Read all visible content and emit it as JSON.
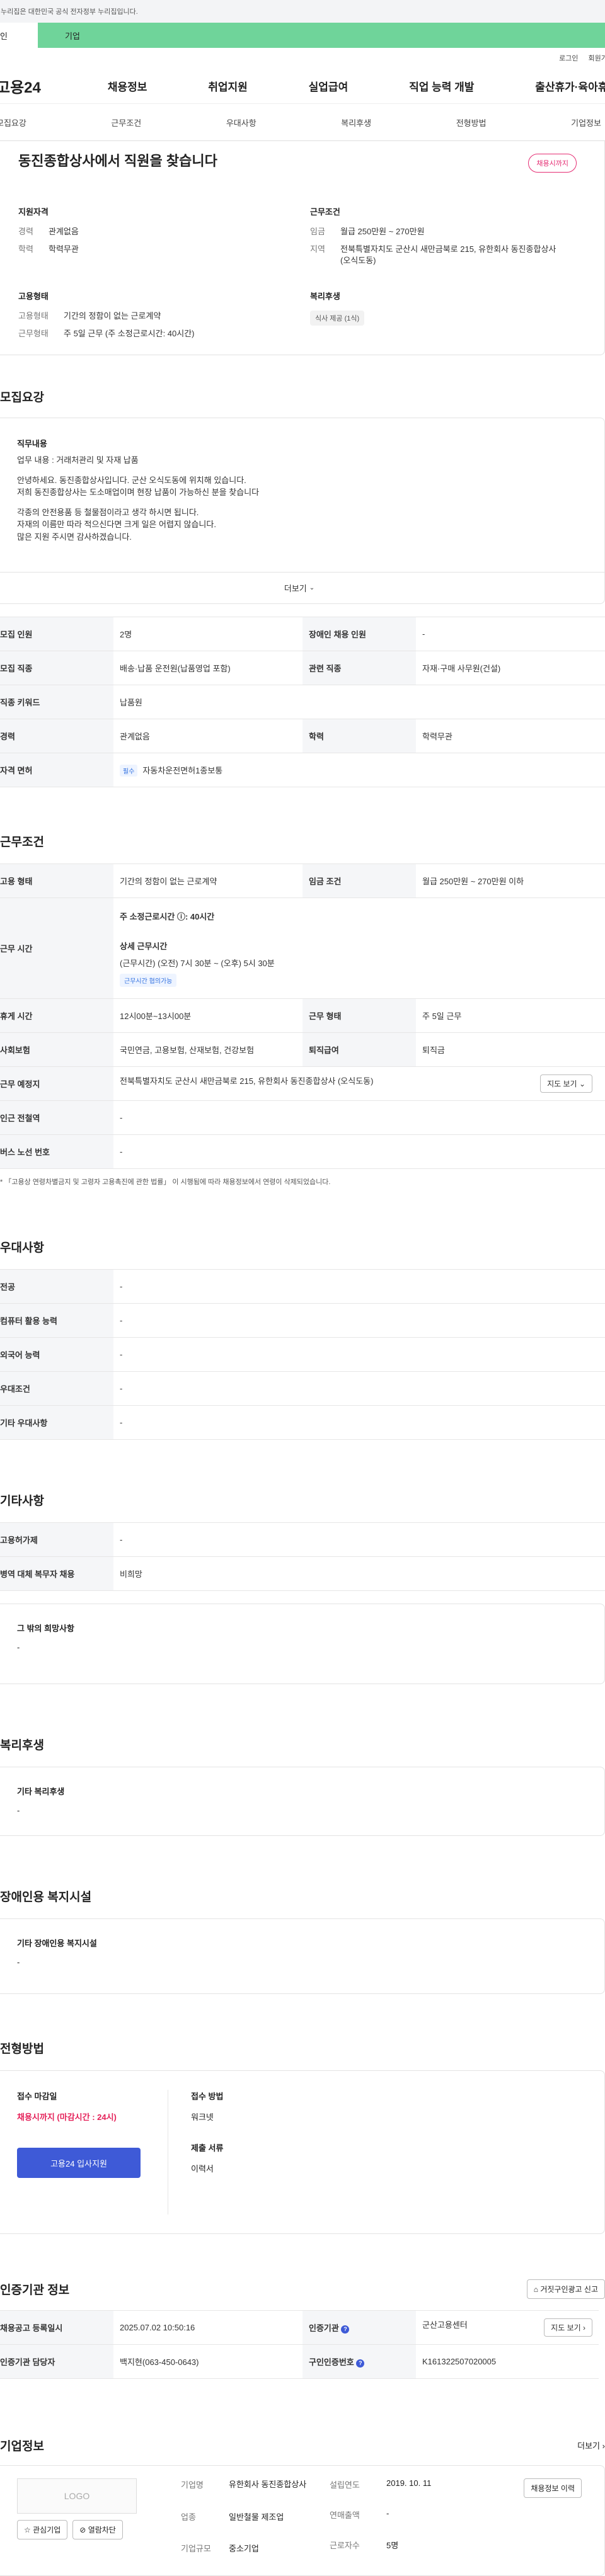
{
  "top_notice": "이 누리집은 대한민국 공식 전자정부 누리집입니다.",
  "mode": {
    "left": "개인",
    "right": "기업"
  },
  "util": {
    "login": "로그인",
    "join": "회원가입"
  },
  "gnb": {
    "logo": "고용24",
    "menus": [
      "채용정보",
      "취업지원",
      "실업급여",
      "직업 능력 개발",
      "출산휴가·육아휴직"
    ]
  },
  "tabs": [
    "모집요강",
    "근무조건",
    "우대사항",
    "복리후생",
    "전형방법",
    "기업정보"
  ],
  "summary": {
    "title": "동진종합상사에서 직원을 찾습니다",
    "badge": "채용시까지",
    "qual_title": "지원자격",
    "qual": [
      {
        "k": "경력",
        "v": "관계없음"
      },
      {
        "k": "학력",
        "v": "학력무관"
      }
    ],
    "cond_title": "근무조건",
    "cond": [
      {
        "k": "임금",
        "v": "월급 250만원 ~ 270만원"
      },
      {
        "k": "지역",
        "v": "전북특별자치도 군산시 새만금북로 215, 유한회사 동진종합상사 (오식도동)"
      }
    ],
    "emp_title": "고용형태",
    "emp": [
      {
        "k": "고용형태",
        "v": "기간의 정함이 없는 근로계약"
      },
      {
        "k": "근무형태",
        "v": "주 5일 근무 (주 소정근로시간: 40시간)"
      }
    ],
    "welfare_title": "복리후생",
    "welfare_chip": "식사 제공 (1식)"
  },
  "recruit": {
    "heading": "모집요강",
    "desc_title": "직무내용",
    "desc_lines": [
      "업무 내용 : 거래처관리 및 자재 납품",
      "",
      "안녕하세요. 동진종합상사입니다. 군산 오식도동에 위치해 있습니다.",
      "저희 동진종합상사는 도소매업이며 현장 납품이 가능하신 분을 찾습니다",
      "",
      "각종의 안전용품 등 철물점이라고 생각 하시면 됩니다.",
      "자재의 이름만 따라 적으신다면 크게 일은 어렵지 않습니다.",
      "많은 지원 주시면 감사하겠습니다."
    ],
    "more": "더보기",
    "rows": {
      "headcount_k": "모집 인원",
      "headcount_v": "2명",
      "disabled_k": "장애인 채용 인원",
      "disabled_v": "-",
      "job_k": "모집 직종",
      "job_v": "배송·납품 운전원(납품영업 포함)",
      "related_k": "관련 직종",
      "related_v": "자재·구매 사무원(건설)",
      "keyword_k": "직종 키워드",
      "keyword_v": "납품원",
      "career_k": "경력",
      "career_v": "관계없음",
      "edu_k": "학력",
      "edu_v": "학력무관",
      "license_k": "자격 면허",
      "license_tag": "필수",
      "license_v": "자동차운전면허1종보통"
    }
  },
  "conditions": {
    "heading": "근무조건",
    "emp_k": "고용 형태",
    "emp_v": "기간의 정함이 없는 근로계약",
    "wage_k": "임금 조건",
    "wage_v": "월급 250만원 ~ 270만원 이하",
    "hours_k": "근무 시간",
    "hours_weekly": "주 소정근로시간 ⓘ: 40시간",
    "hours_detail_title": "상세 근무시간",
    "hours_detail": "(근무시간) (오전) 7시 30분 ~ (오후) 5시 30분",
    "hours_tag": "근무시간 협의가능",
    "break_k": "휴게 시간",
    "break_v": "12시00분~13시00분",
    "form_k": "근무 형태",
    "form_v": "주 5일 근무",
    "insurance_k": "사회보험",
    "insurance_v": "국민연금, 고용보험, 산재보험, 건강보험",
    "severance_k": "퇴직급여",
    "severance_v": "퇴직금",
    "place_k": "근무 예정지",
    "place_v": "전북특별자치도 군산시 새만금북로 215, 유한회사 동진종합상사 (오식도동)",
    "map_btn": "지도 보기",
    "station_k": "인근 전철역",
    "station_v": "-",
    "bus_k": "버스 노선 번호",
    "bus_v": "-",
    "note": "* 「고용상 연령차별금지 및 고령자 고용촉진에 관한 법률」 이 시행됨에 따라 채용정보에서 연령이 삭제되었습니다."
  },
  "preferences": {
    "heading": "우대사항",
    "rows": [
      {
        "k": "전공",
        "v": "-"
      },
      {
        "k": "컴퓨터 활용 능력",
        "v": "-"
      },
      {
        "k": "외국어 능력",
        "v": "-"
      },
      {
        "k": "우대조건",
        "v": "-"
      },
      {
        "k": "기타 우대사항",
        "v": "-"
      }
    ]
  },
  "etc": {
    "heading": "기타사항",
    "rows": [
      {
        "k": "고용허가제",
        "v": "-"
      },
      {
        "k": "병역 대체 복무자 채용",
        "v": "비희망"
      }
    ],
    "other_title": "그 밖의 희망사항",
    "other_v": "-"
  },
  "welfare": {
    "heading": "복리후생",
    "title": "기타 복리후생",
    "v": "-"
  },
  "disabled": {
    "heading": "장애인용 복지시설",
    "title": "기타 장애인용 복지시설",
    "v": "-"
  },
  "selection": {
    "heading": "전형방법",
    "deadline_title": "접수 마감일",
    "deadline": "채용시까지 (마감시간 : 24시)",
    "apply_btn": "고용24 입사지원",
    "method_title": "접수 방법",
    "method": "워크넷",
    "docs_title": "제출 서류",
    "docs": "이력서"
  },
  "certification": {
    "heading": "인증기관 정보",
    "report_btn": "거짓구인광고 신고",
    "reg_k": "채용공고 등록일시",
    "reg_v": "2025.07.02 10:50:16",
    "agency_k": "인증기관",
    "agency_v": "군산고용센터",
    "map_btn": "지도 보기",
    "manager_k": "인증기관 담당자",
    "manager_v": "백지현(063-450-0643)",
    "cert_no_k": "구인인증번호",
    "cert_no_v": "K161322507020005"
  },
  "company": {
    "heading": "기업정보",
    "more": "더보기",
    "logo": "LOGO",
    "fav_btn": "관심기업",
    "block_btn": "열람차단",
    "name_k": "기업명",
    "name_v": "유한회사 동진종합상사",
    "industry_k": "업종",
    "industry_v": "일반철물 제조업",
    "size_k": "기업규모",
    "size_v": "중소기업",
    "year_k": "설립연도",
    "year_v": "2019. 10. 11",
    "sales_k": "연매출액",
    "sales_v": "-",
    "employees_k": "근로자수",
    "employees_v": "5명",
    "history_btn": "채용정보 이력"
  }
}
